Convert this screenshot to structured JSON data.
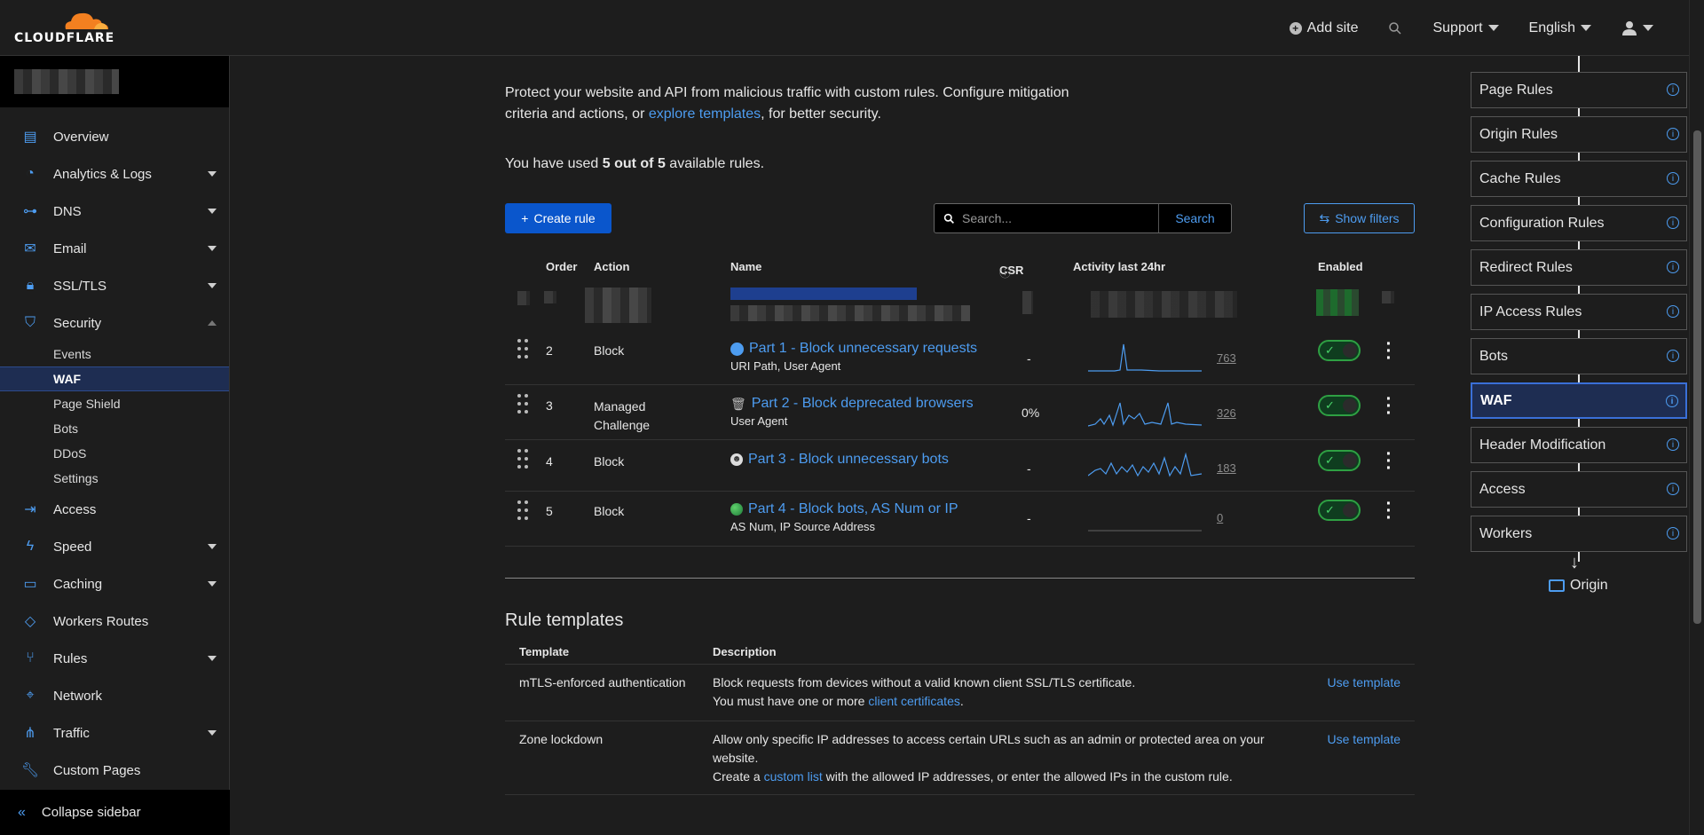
{
  "brand": {
    "name": "CLOUDFLARE",
    "accent": "#f38020",
    "link": "#4d9cf0"
  },
  "topnav": {
    "add_site": "Add site",
    "support": "Support",
    "language": "English"
  },
  "sidebar": {
    "items": [
      {
        "label": "Overview"
      },
      {
        "label": "Analytics & Logs"
      },
      {
        "label": "DNS"
      },
      {
        "label": "Email"
      },
      {
        "label": "SSL/TLS"
      },
      {
        "label": "Security"
      }
    ],
    "security_sub": [
      "Events",
      "WAF",
      "Page Shield",
      "Bots",
      "DDoS",
      "Settings"
    ],
    "items2": [
      {
        "label": "Access"
      },
      {
        "label": "Speed"
      },
      {
        "label": "Caching"
      },
      {
        "label": "Workers Routes"
      },
      {
        "label": "Rules"
      },
      {
        "label": "Network"
      },
      {
        "label": "Traffic"
      },
      {
        "label": "Custom Pages"
      }
    ],
    "collapse": "Collapse sidebar"
  },
  "main": {
    "intro_1": "Protect your website and API from malicious traffic with custom rules. Configure mitigation criteria and actions, or ",
    "intro_link": "explore templates",
    "intro_2": ", for better security.",
    "usage_1": "You have used ",
    "usage_bold": "5 out of 5",
    "usage_2": " available rules.",
    "create_rule": "Create rule",
    "search_placeholder": "Search...",
    "search_btn": "Search",
    "show_filters": "Show filters",
    "columns": {
      "order": "Order",
      "action": "Action",
      "name": "Name",
      "csr": "CSR",
      "activity": "Activity last 24hr",
      "enabled": "Enabled"
    },
    "rules": [
      {
        "order": "2",
        "action": "Block",
        "name": "Part 1 - Block unnecessary requests",
        "fields": "URI Path, User Agent",
        "csr": "-",
        "count": "763"
      },
      {
        "order": "3",
        "action": "Managed Challenge",
        "name": "Part 2 - Block deprecated browsers",
        "fields": "User Agent",
        "csr": "0%",
        "count": "326"
      },
      {
        "order": "4",
        "action": "Block",
        "name": "Part 3 - Block unnecessary bots",
        "fields": "",
        "csr": "-",
        "count": "183"
      },
      {
        "order": "5",
        "action": "Block",
        "name": "Part 4 - Block bots, AS Num or IP",
        "fields": "AS Num, IP Source Address",
        "csr": "-",
        "count": "0"
      }
    ],
    "templates": {
      "title": "Rule templates",
      "col_template": "Template",
      "col_description": "Description",
      "use": "Use template",
      "rows": [
        {
          "name": "mTLS-enforced authentication",
          "desc_1": "Block requests from devices without a valid known client SSL/TLS certificate.",
          "desc_2a": "You must have one or more ",
          "desc_link": "client certificates",
          "desc_2b": "."
        },
        {
          "name": "Zone lockdown",
          "desc_1": "Allow only specific IP addresses to access certain URLs such as an admin or protected area on your website.",
          "desc_2a": "Create a ",
          "desc_link": "custom list",
          "desc_2b": " with the allowed IP addresses, or enter the allowed IPs in the custom rule."
        }
      ]
    }
  },
  "flow": {
    "cards": [
      "Page Rules",
      "Origin Rules",
      "Cache Rules",
      "Configuration Rules",
      "Redirect Rules",
      "IP Access Rules",
      "Bots",
      "WAF",
      "Header Modification",
      "Access",
      "Workers"
    ],
    "active": "WAF",
    "origin": "Origin"
  }
}
